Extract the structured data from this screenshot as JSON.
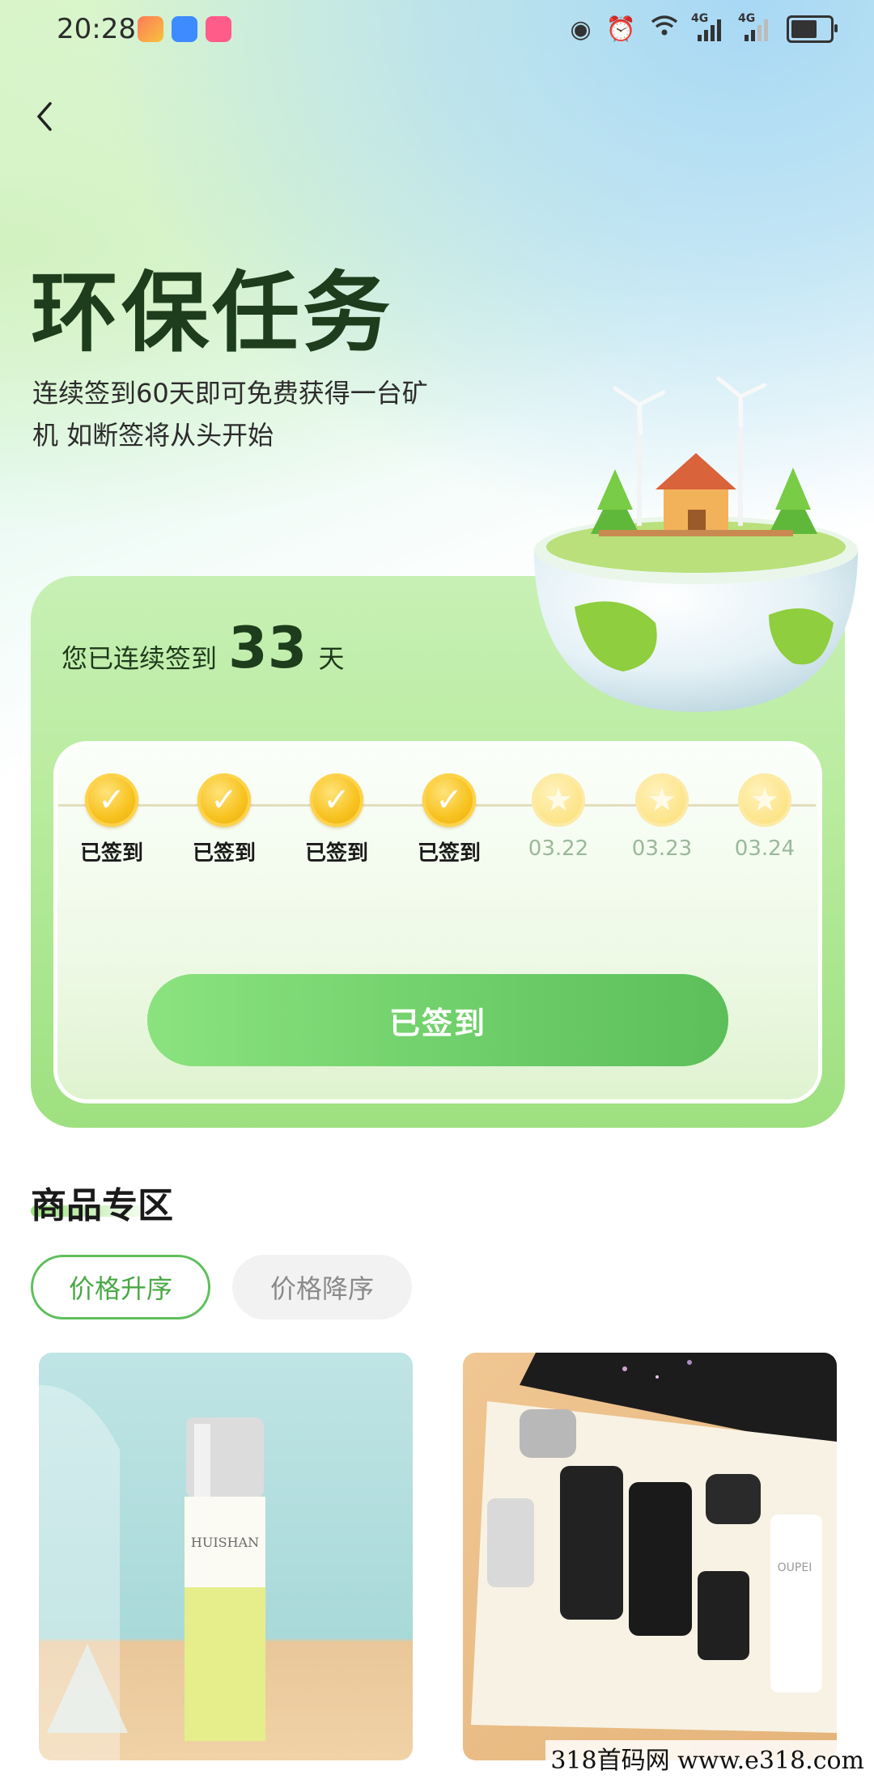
{
  "status_bar": {
    "time": "20:28",
    "network_1": "4G",
    "network_2": "4G"
  },
  "header": {
    "title": "环保任务",
    "description": "连续签到60天即可免费获得一台矿机 如断签将从头开始"
  },
  "checkin": {
    "streak_prefix": "您已连续签到",
    "streak_days": "33",
    "streak_suffix": "天",
    "days": [
      {
        "label": "已签到",
        "signed": true
      },
      {
        "label": "已签到",
        "signed": true
      },
      {
        "label": "已签到",
        "signed": true
      },
      {
        "label": "已签到",
        "signed": true
      },
      {
        "label": "03.22",
        "signed": false
      },
      {
        "label": "03.23",
        "signed": false
      },
      {
        "label": "03.24",
        "signed": false
      }
    ],
    "button_label": "已签到"
  },
  "products": {
    "section_title": "商品专区",
    "sort_asc": "价格升序",
    "sort_desc": "价格降序",
    "items": [
      {
        "brand": "HUISHAN",
        "image": "yellow-toner-bottle"
      },
      {
        "brand": "OUPEI",
        "image": "skincare-gift-set"
      }
    ]
  },
  "watermark": "318首码网 www.e318.com",
  "colors": {
    "accent_green": "#6fcf6a",
    "title_green": "#1e3d1c",
    "coin_gold": "#f7c21e"
  }
}
